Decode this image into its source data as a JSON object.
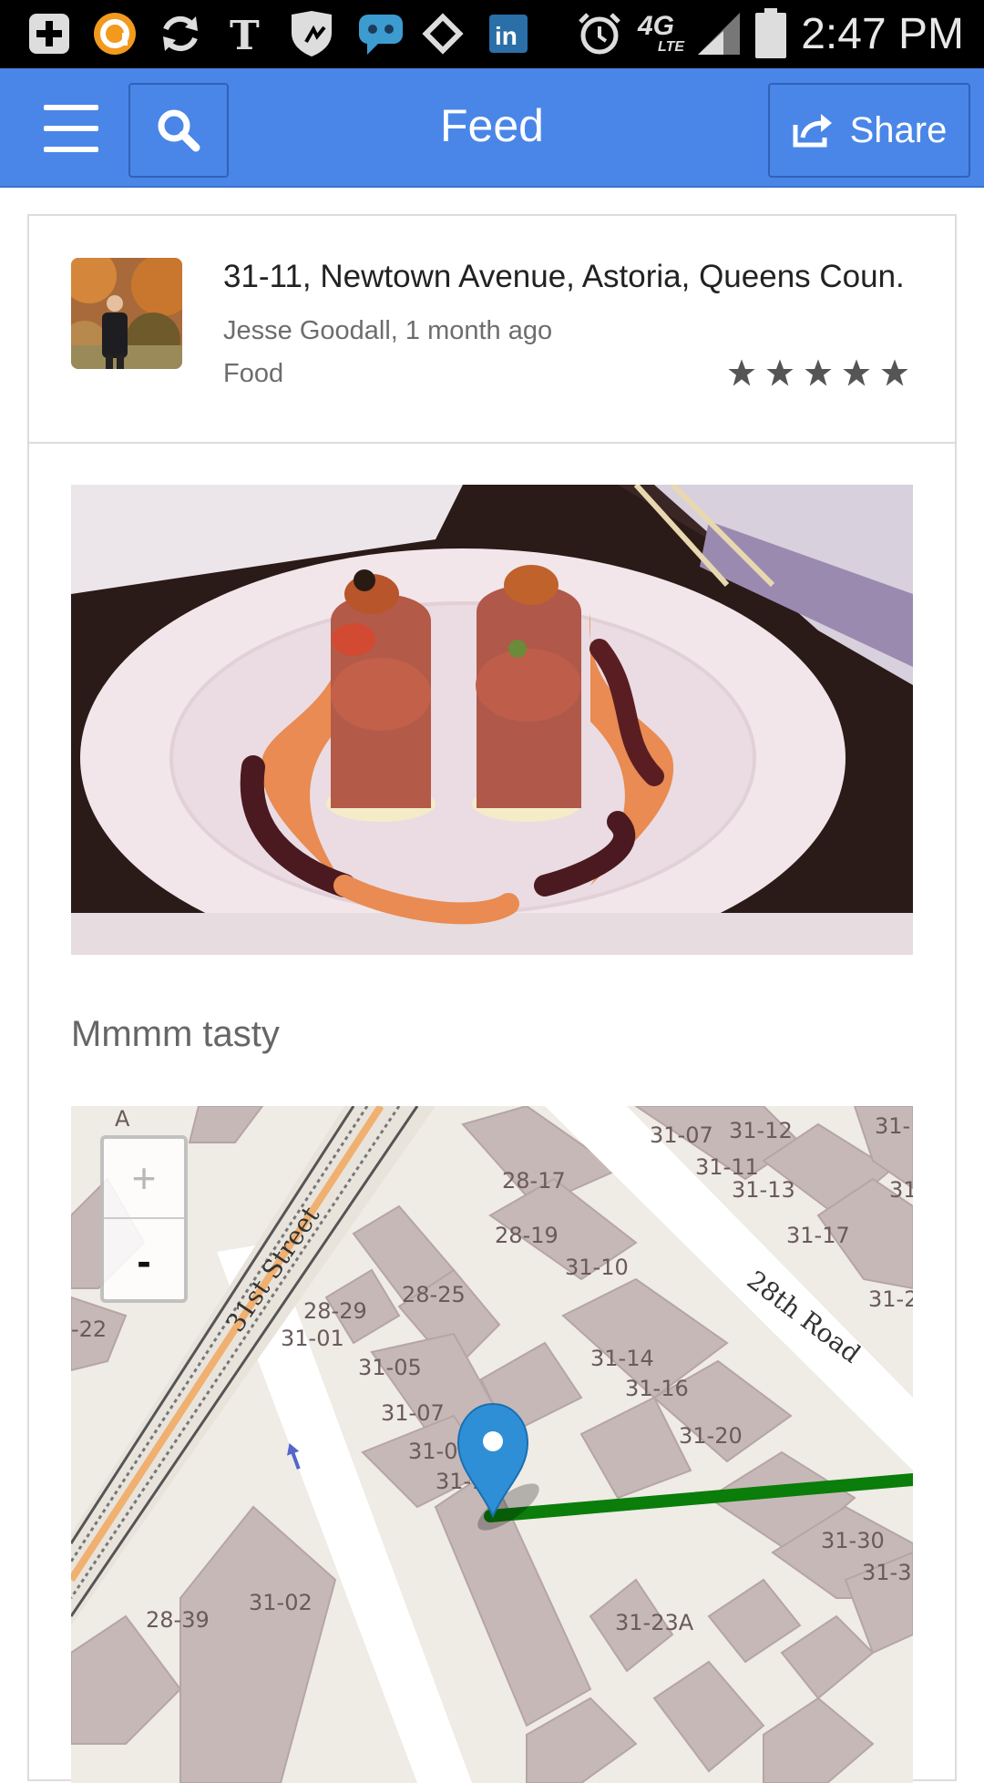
{
  "status_bar": {
    "time": "2:47 PM",
    "network": "4G",
    "network_sub": "LTE",
    "icons": [
      "add-icon",
      "circle-app-icon",
      "sync-icon",
      "nyt-icon",
      "shield-icon",
      "chat-bubble-icon",
      "badge-icon",
      "linkedin-icon",
      "alarm-icon",
      "signal-icon",
      "battery-icon"
    ]
  },
  "app_bar": {
    "title": "Feed",
    "share_label": "Share",
    "color": "#4a86e8"
  },
  "post": {
    "address": "31-11, Newtown Avenue, Astoria, Queens Coun.",
    "author_line": "Jesse Goodall, 1 month ago",
    "category": "Food",
    "rating": 5,
    "caption": "Mmmm tasty"
  },
  "map": {
    "zoom_in": "+",
    "zoom_out": "-",
    "street_labels": [
      "31st Street",
      "28th Road"
    ],
    "building_labels": [
      "31-07",
      "31-12",
      "31-11",
      "31-13",
      "28-17",
      "28-19",
      "31-10",
      "31-17",
      "28-25",
      "28-29",
      "31-01",
      "31-05",
      "31-07",
      "31-14",
      "31-16",
      "31-20",
      "31-09",
      "31-1",
      "31-30",
      "31-3",
      "31-02",
      "28-39",
      "31-23A",
      "-22",
      "31-",
      "31-2",
      "31",
      "A"
    ]
  }
}
